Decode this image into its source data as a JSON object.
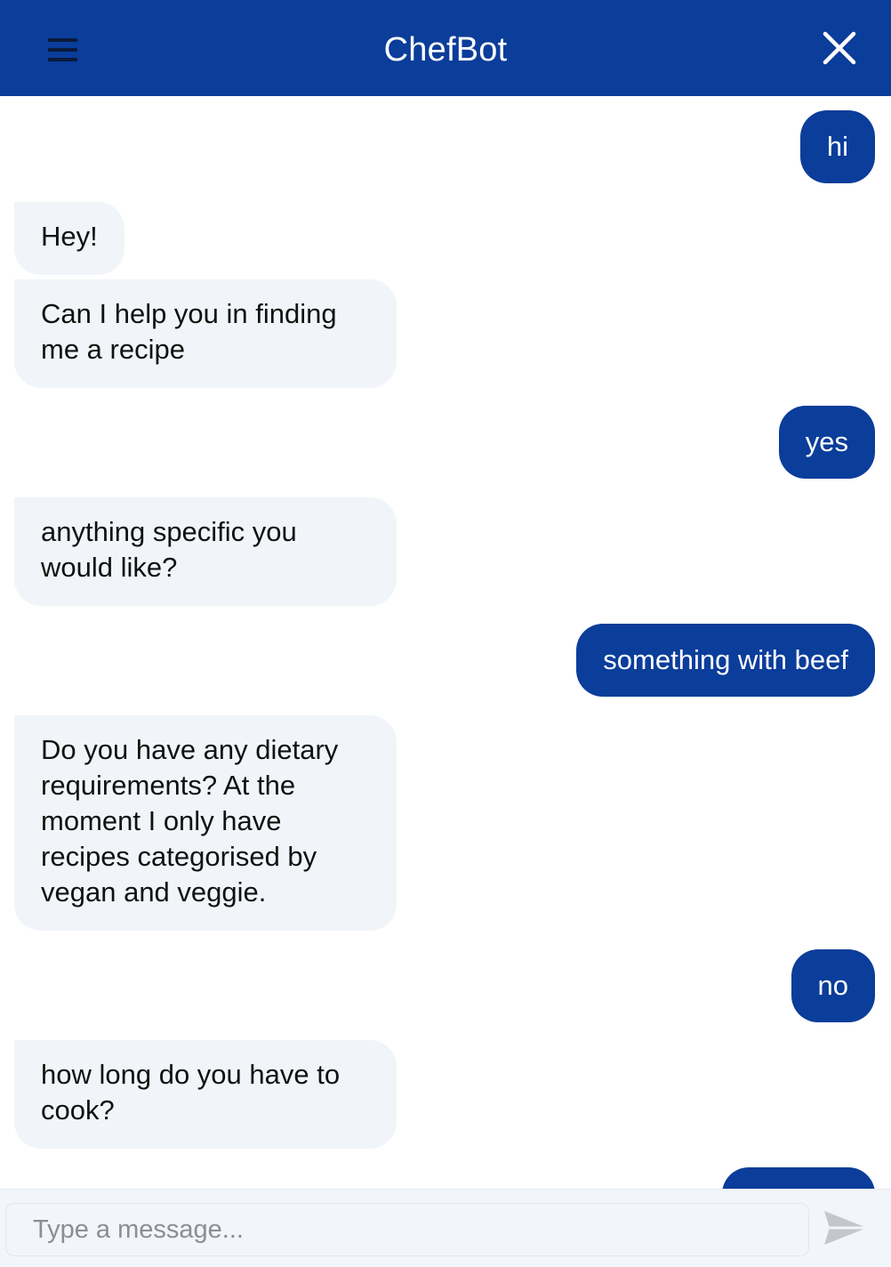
{
  "header": {
    "title": "ChefBot",
    "menu_icon": "hamburger-menu-icon",
    "close_icon": "close-icon"
  },
  "colors": {
    "brand": "#0b3d9a",
    "bot_bubble": "#f1f5f9",
    "composer_bg": "#f2f5f9"
  },
  "messages": [
    {
      "sender": "user",
      "text": "hi"
    },
    {
      "sender": "bot",
      "text": "Hey!"
    },
    {
      "sender": "bot",
      "text": "Can I help you in finding\nme a recipe"
    },
    {
      "sender": "user",
      "text": "yes"
    },
    {
      "sender": "bot",
      "text": "anything specific you\nwould like?"
    },
    {
      "sender": "user",
      "text": "something with beef"
    },
    {
      "sender": "bot",
      "text": "Do you have any dietary\nrequirements? At the\nmoment I only have\nrecipes categorised by\nvegan and veggie."
    },
    {
      "sender": "user",
      "text": "no"
    },
    {
      "sender": "bot",
      "text": "how long do you have to\ncook?"
    },
    {
      "sender": "user",
      "text": ""
    }
  ],
  "composer": {
    "placeholder": "Type a message...",
    "value": "",
    "send_icon": "send-icon"
  }
}
